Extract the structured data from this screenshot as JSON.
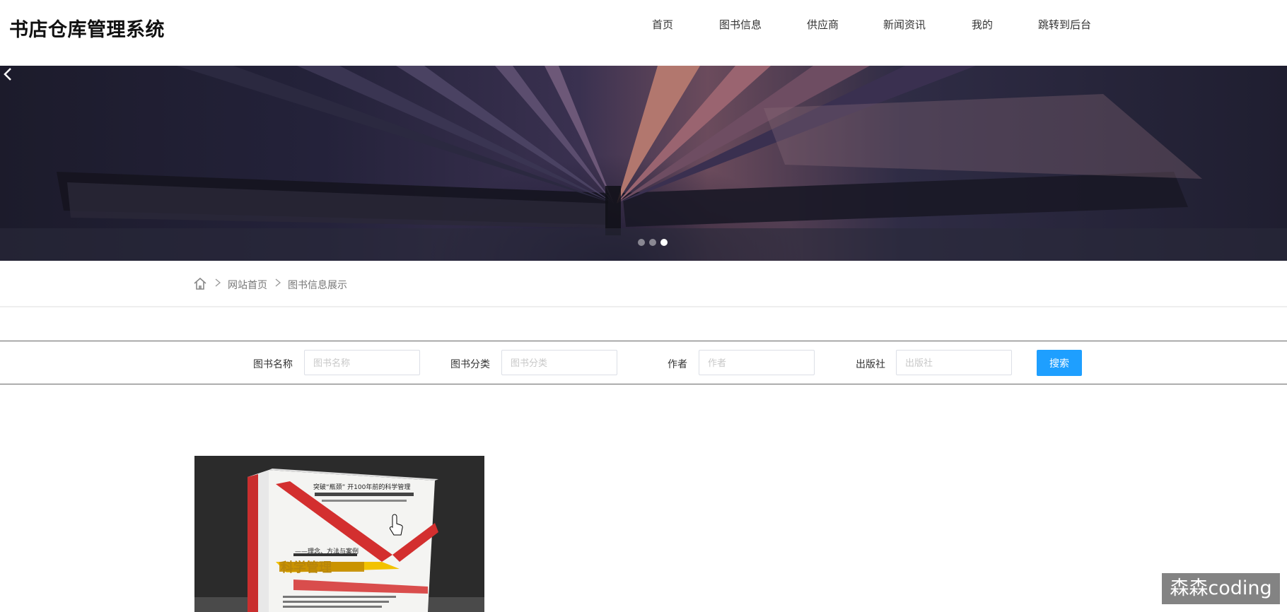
{
  "header": {
    "site_title": "书店仓库管理系统",
    "nav": [
      {
        "label": "首页"
      },
      {
        "label": "图书信息"
      },
      {
        "label": "供应商"
      },
      {
        "label": "新闻资讯"
      },
      {
        "label": "我的"
      },
      {
        "label": "跳转到后台"
      }
    ]
  },
  "banner": {
    "slide_count": 3,
    "active_slide": 3,
    "prev_icon": "chevron-left-icon"
  },
  "breadcrumb": {
    "home_icon": "home-icon",
    "items": [
      "网站首页",
      "图书信息展示"
    ]
  },
  "search": {
    "fields": [
      {
        "label": "图书名称",
        "placeholder": "图书名称",
        "value": ""
      },
      {
        "label": "图书分类",
        "placeholder": "图书分类",
        "value": ""
      },
      {
        "label": "作者",
        "placeholder": "作者",
        "value": ""
      },
      {
        "label": "出版社",
        "placeholder": "出版社",
        "value": ""
      }
    ],
    "button_label": "搜索",
    "button_color": "#1e9fff"
  },
  "books": [
    {
      "cover_headline": "突破“瓶颈” 开100年前的科学管理",
      "cover_subtitle": "——理念、方法与案例",
      "cover_title": "科学管理"
    }
  ],
  "watermark": "森森coding"
}
